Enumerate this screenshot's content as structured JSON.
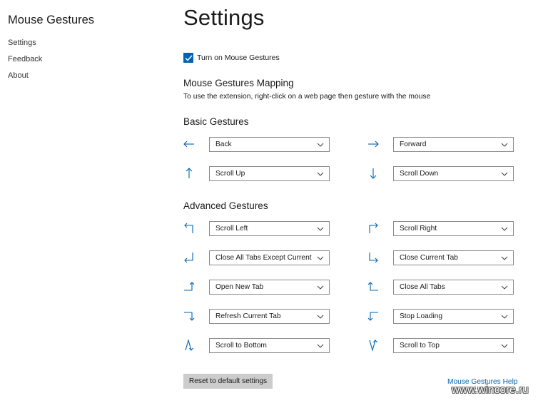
{
  "sidebar": {
    "app_title": "Mouse Gestures",
    "items": [
      {
        "label": "Settings"
      },
      {
        "label": "Feedback"
      },
      {
        "label": "About"
      }
    ]
  },
  "main": {
    "title": "Settings",
    "toggle": {
      "label": "Turn on Mouse Gestures",
      "checked": true
    },
    "mapping_title": "Mouse Gestures Mapping",
    "mapping_desc": "To use the extension, right-click on a web page then gesture with the mouse",
    "basic_title": "Basic Gestures",
    "basic": [
      {
        "icon": "arrow-left-icon",
        "value": "Back"
      },
      {
        "icon": "arrow-right-icon",
        "value": "Forward"
      },
      {
        "icon": "arrow-up-icon",
        "value": "Scroll Up"
      },
      {
        "icon": "arrow-down-icon",
        "value": "Scroll Down"
      }
    ],
    "advanced_title": "Advanced Gestures",
    "advanced": [
      {
        "icon": "up-left-icon",
        "value": "Scroll Left"
      },
      {
        "icon": "up-right-icon",
        "value": "Scroll Right"
      },
      {
        "icon": "down-left-icon",
        "value": "Close All Tabs Except Current"
      },
      {
        "icon": "down-right-icon",
        "value": "Close Current Tab"
      },
      {
        "icon": "right-up-icon",
        "value": "Open New Tab"
      },
      {
        "icon": "left-up-icon",
        "value": "Close All Tabs"
      },
      {
        "icon": "right-down-icon",
        "value": "Refresh Current Tab"
      },
      {
        "icon": "left-down-icon",
        "value": "Stop Loading"
      },
      {
        "icon": "up-down-icon",
        "value": "Scroll to Bottom"
      },
      {
        "icon": "down-up-icon",
        "value": "Scroll to Top"
      }
    ],
    "reset_label": "Reset to default settings",
    "help_label": "Mouse Gestures Help"
  },
  "watermark": "www.wincore.ru",
  "colors": {
    "accent": "#0063b1",
    "button_bg": "#cccccc",
    "border": "#8a8a8a"
  }
}
